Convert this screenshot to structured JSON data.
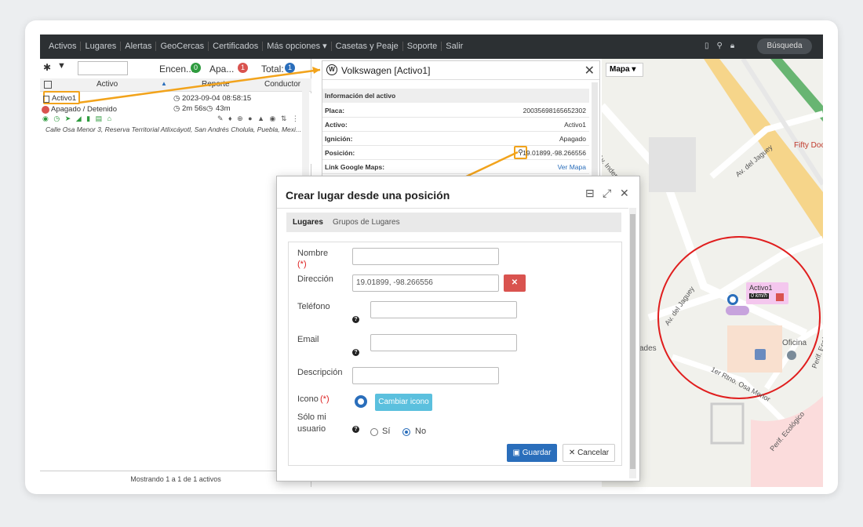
{
  "nav": {
    "items": [
      "Activos",
      "Lugares",
      "Alertas",
      "GeoCercas",
      "Certificados",
      "Más opciones ▾",
      "Casetas y Peaje",
      "Soporte",
      "Salir"
    ],
    "search_label": "Búsqueda"
  },
  "left": {
    "encendidos_label": "Encen...",
    "encendidos_count": "0",
    "apagados_label": "Apa...",
    "apagados_count": "1",
    "total_label": "Total:",
    "total_count": "1",
    "col_activo": "Activo",
    "col_reporte": "Reporte",
    "col_conductor": "Conductor",
    "asset_name": "Activo1",
    "asset_status": "Apagado / Detenido",
    "report_time": "2023-09-04 08:58:15",
    "duration1": "2m 56s",
    "duration2": "43m",
    "address": "Calle Osa Menor 3, Reserva Territorial Atlixcáyotl, San Andrés Cholula, Puebla, Mexi...",
    "footer": "Mostrando 1 a 1 de 1 activos"
  },
  "info": {
    "title": "Volkswagen [Activo1]",
    "section": "Información del activo",
    "rows": [
      {
        "k": "Placa:",
        "v": "20035698165652302"
      },
      {
        "k": "Activo:",
        "v": "Activo1"
      },
      {
        "k": "Ignición:",
        "v": "Apagado"
      },
      {
        "k": "Posición:",
        "v": "19.01899,-98.266556"
      },
      {
        "k": "Link Google Maps:",
        "v": "Ver Mapa"
      }
    ]
  },
  "map": {
    "dropdown": "Mapa ▾",
    "streets": [
      "Av. Independencia",
      "Av. del Jaguey",
      "Av. del Jaguey",
      "1er Rtno. Osa Menor",
      "Perif. Ecológico",
      "Perif. Ecológico",
      "Fifty Doc",
      "ades",
      "Oficina"
    ],
    "asset_label": "Activo1",
    "asset_speed": "0 km/h"
  },
  "dialog": {
    "title": "Crear lugar desde una posición",
    "tab1": "Lugares",
    "tab2": "Grupos de Lugares",
    "nombre": "Nombre",
    "direccion": "Dirección",
    "direccion_value": "19.01899, -98.266556",
    "telefono": "Teléfono",
    "email": "Email",
    "descripcion": "Descripción",
    "icono": "Icono",
    "solo": "Sólo mi usuario",
    "si": "Sí",
    "no": "No",
    "cambiar": "Cambiar icono",
    "guardar": "Guardar",
    "cancelar": "Cancelar",
    "required": "(*)"
  },
  "colors": {
    "accent": "#5bc0de",
    "primary": "#2a6ebb",
    "danger": "#d9534f",
    "arrow": "#f2a31b"
  }
}
